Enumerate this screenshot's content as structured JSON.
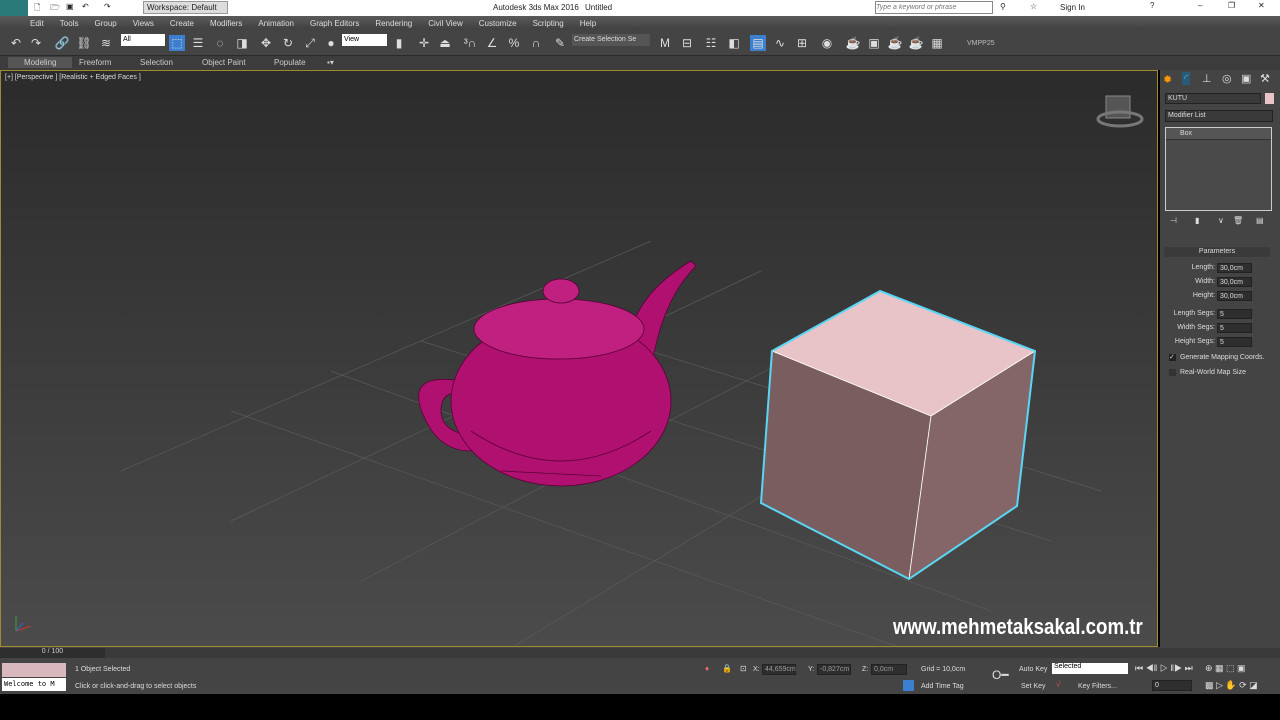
{
  "title": {
    "app": "Autodesk 3ds Max 2016",
    "doc": "Untitled",
    "workspace": "Workspace: Default",
    "search_placeholder": "Type a keyword or phrase",
    "sign_in": "Sign In",
    "logo": "MAX"
  },
  "menu": [
    "Edit",
    "Tools",
    "Group",
    "Views",
    "Create",
    "Modifiers",
    "Animation",
    "Graph Editors",
    "Rendering",
    "Civil View",
    "Customize",
    "Scripting",
    "Help"
  ],
  "toolbar": {
    "filter": "All",
    "ref_coord": "View",
    "named_selection": "Create Selection Se",
    "vmpp": "VMPP25"
  },
  "ribbon": [
    "Modeling",
    "Freeform",
    "Selection",
    "Object Paint",
    "Populate"
  ],
  "viewport": {
    "label": "[+] [Perspective ] [Realistic + Edged Faces ]"
  },
  "watermark": "www.mehmetaksakal.com.tr",
  "command_panel": {
    "object_name": "KUTU",
    "object_color": "#e8c4c8",
    "modifier_list": "Modifier List",
    "stack": [
      "Box"
    ],
    "rollout": "Parameters",
    "params": [
      {
        "label": "Length:",
        "value": "30,0cm"
      },
      {
        "label": "Width:",
        "value": "30,0cm"
      },
      {
        "label": "Height:",
        "value": "30,0cm"
      },
      {
        "label": "Length Segs:",
        "value": "5"
      },
      {
        "label": "Width Segs:",
        "value": "5"
      },
      {
        "label": "Height Segs:",
        "value": "5"
      }
    ],
    "checkboxes": [
      {
        "label": "Generate Mapping Coords.",
        "checked": true
      },
      {
        "label": "Real-World Map Size",
        "checked": false
      }
    ]
  },
  "status": {
    "time": "0 / 100",
    "selected": "1 Object Selected",
    "prompt": "Click or click-and-drag to select objects",
    "listener": "Welcome to M",
    "x": "44,659cm",
    "y": "-0,827cm",
    "z": "0,0cm",
    "grid": "Grid = 10,0cm",
    "add_time_tag": "Add Time Tag",
    "auto_key": "Auto Key",
    "set_key": "Set Key",
    "key_mode": "Selected",
    "key_filters": "Key Filters...",
    "frame": "0",
    "x_label": "X:",
    "y_label": "Y:",
    "z_label": "Z:"
  }
}
